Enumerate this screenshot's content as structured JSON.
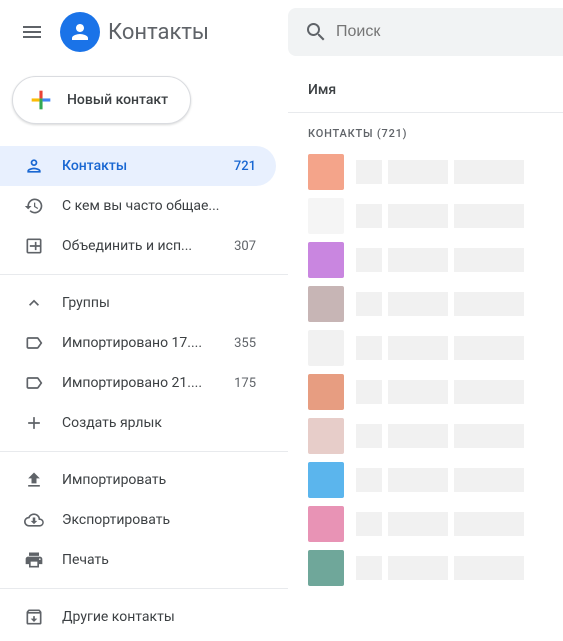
{
  "header": {
    "title": "Контакты"
  },
  "create": {
    "label": "Новый контакт"
  },
  "nav": {
    "contacts": {
      "label": "Контакты",
      "count": "721"
    },
    "frequent": {
      "label": "С кем вы часто общае..."
    },
    "merge": {
      "label": "Объединить и исп...",
      "count": "307"
    },
    "groups": {
      "label": "Группы"
    },
    "import1": {
      "label": "Импортировано 17....",
      "count": "355"
    },
    "import2": {
      "label": "Импортировано 21....",
      "count": "175"
    },
    "createLabel": {
      "label": "Создать ярлык"
    },
    "importAction": {
      "label": "Импортировать"
    },
    "exportAction": {
      "label": "Экспортировать"
    },
    "print": {
      "label": "Печать"
    },
    "other": {
      "label": "Другие контакты"
    }
  },
  "search": {
    "placeholder": "Поиск"
  },
  "list": {
    "columnHeader": "Имя",
    "sectionLabel": "КОНТАКТЫ (721)",
    "contacts": [
      {
        "color": "#f4a48a"
      },
      {
        "color": "#f5f5f5"
      },
      {
        "color": "#c986e0"
      },
      {
        "color": "#c7b5b5"
      },
      {
        "color": "#f1f1f1"
      },
      {
        "color": "#e79d81"
      },
      {
        "color": "#e7cdc9"
      },
      {
        "color": "#5bb5ed"
      },
      {
        "color": "#e893b5"
      },
      {
        "color": "#6fa79a"
      }
    ]
  }
}
